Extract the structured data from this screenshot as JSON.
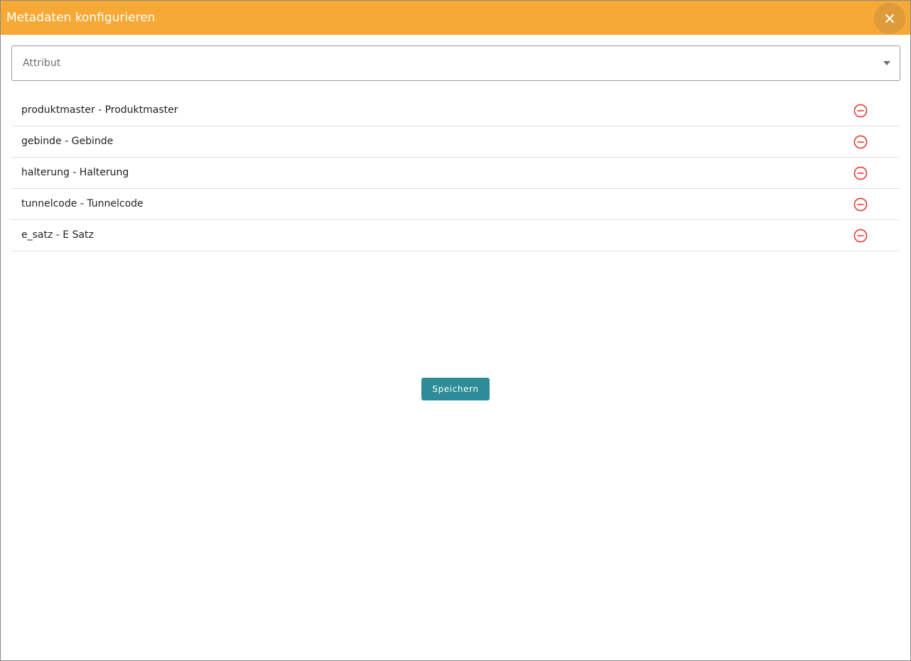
{
  "dialog": {
    "title": "Metadaten konfigurieren",
    "close_icon": "close-icon",
    "header_color": "#f6a935"
  },
  "attribute_select": {
    "placeholder": "Attribut",
    "value": "",
    "arrow_icon": "caret-down-icon"
  },
  "metadata_items": [
    {
      "label": "produktmaster - Produktmaster",
      "remove_icon": "minus-circle-icon"
    },
    {
      "label": "gebinde - Gebinde",
      "remove_icon": "minus-circle-icon"
    },
    {
      "label": "halterung - Halterung",
      "remove_icon": "minus-circle-icon"
    },
    {
      "label": "tunnelcode - Tunnelcode",
      "remove_icon": "minus-circle-icon"
    },
    {
      "label": "e_satz - E Satz",
      "remove_icon": "minus-circle-icon"
    }
  ],
  "actions": {
    "save_label": "Speichern",
    "save_color": "#2e8c98"
  },
  "colors": {
    "remove_icon": "#e53935"
  }
}
